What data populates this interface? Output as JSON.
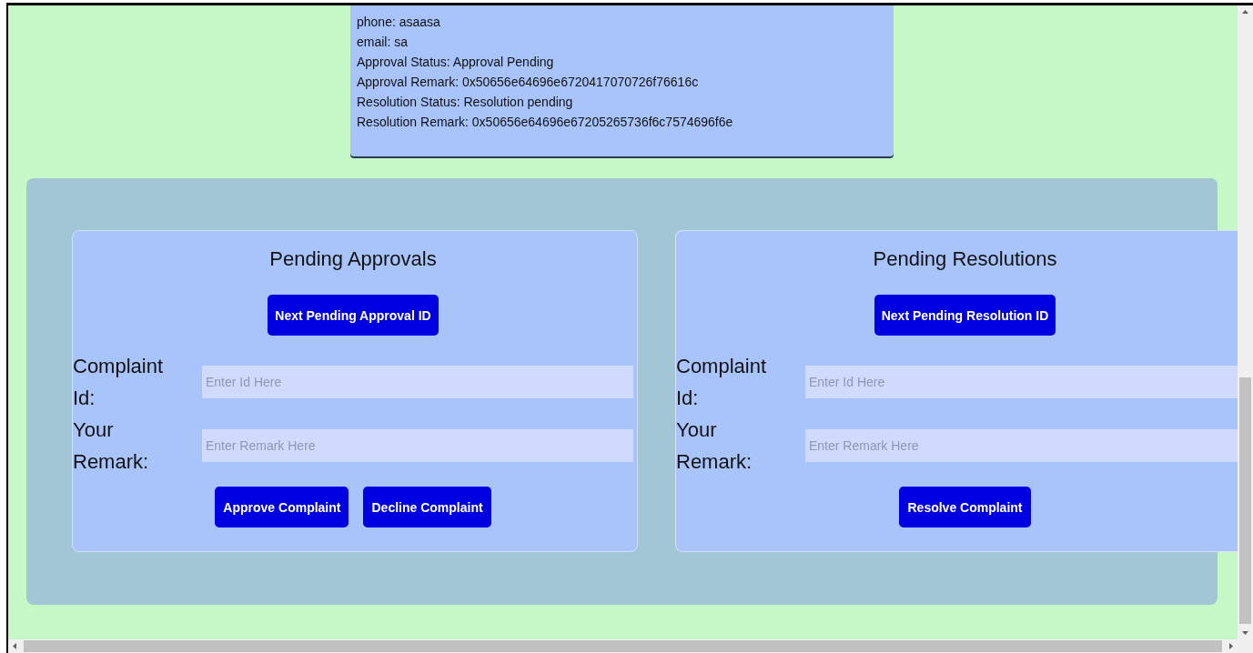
{
  "record": {
    "lines": [
      "phone: asaasa",
      "email: sa",
      "Approval Status: Approval Pending",
      "Approval Remark: 0x50656e64696e6720417070726f76616c",
      "Resolution Status: Resolution pending",
      "Resolution Remark: 0x50656e64696e67205265736f6c7574696f6e"
    ]
  },
  "panels": [
    {
      "title": "Pending Approvals",
      "next_button": "Next Pending Approval ID",
      "fields": [
        {
          "label": "Complaint Id:",
          "placeholder": "Enter Id Here"
        },
        {
          "label": "Your Remark:",
          "placeholder": "Enter Remark Here"
        }
      ],
      "actions": [
        "Approve Complaint",
        "Decline Complaint"
      ]
    },
    {
      "title": "Pending Resolutions",
      "next_button": "Next Pending Resolution ID",
      "fields": [
        {
          "label": "Complaint Id:",
          "placeholder": "Enter Id Here"
        },
        {
          "label": "Your Remark:",
          "placeholder": "Enter Remark Here"
        }
      ],
      "actions": [
        "Resolve Complaint"
      ]
    }
  ]
}
